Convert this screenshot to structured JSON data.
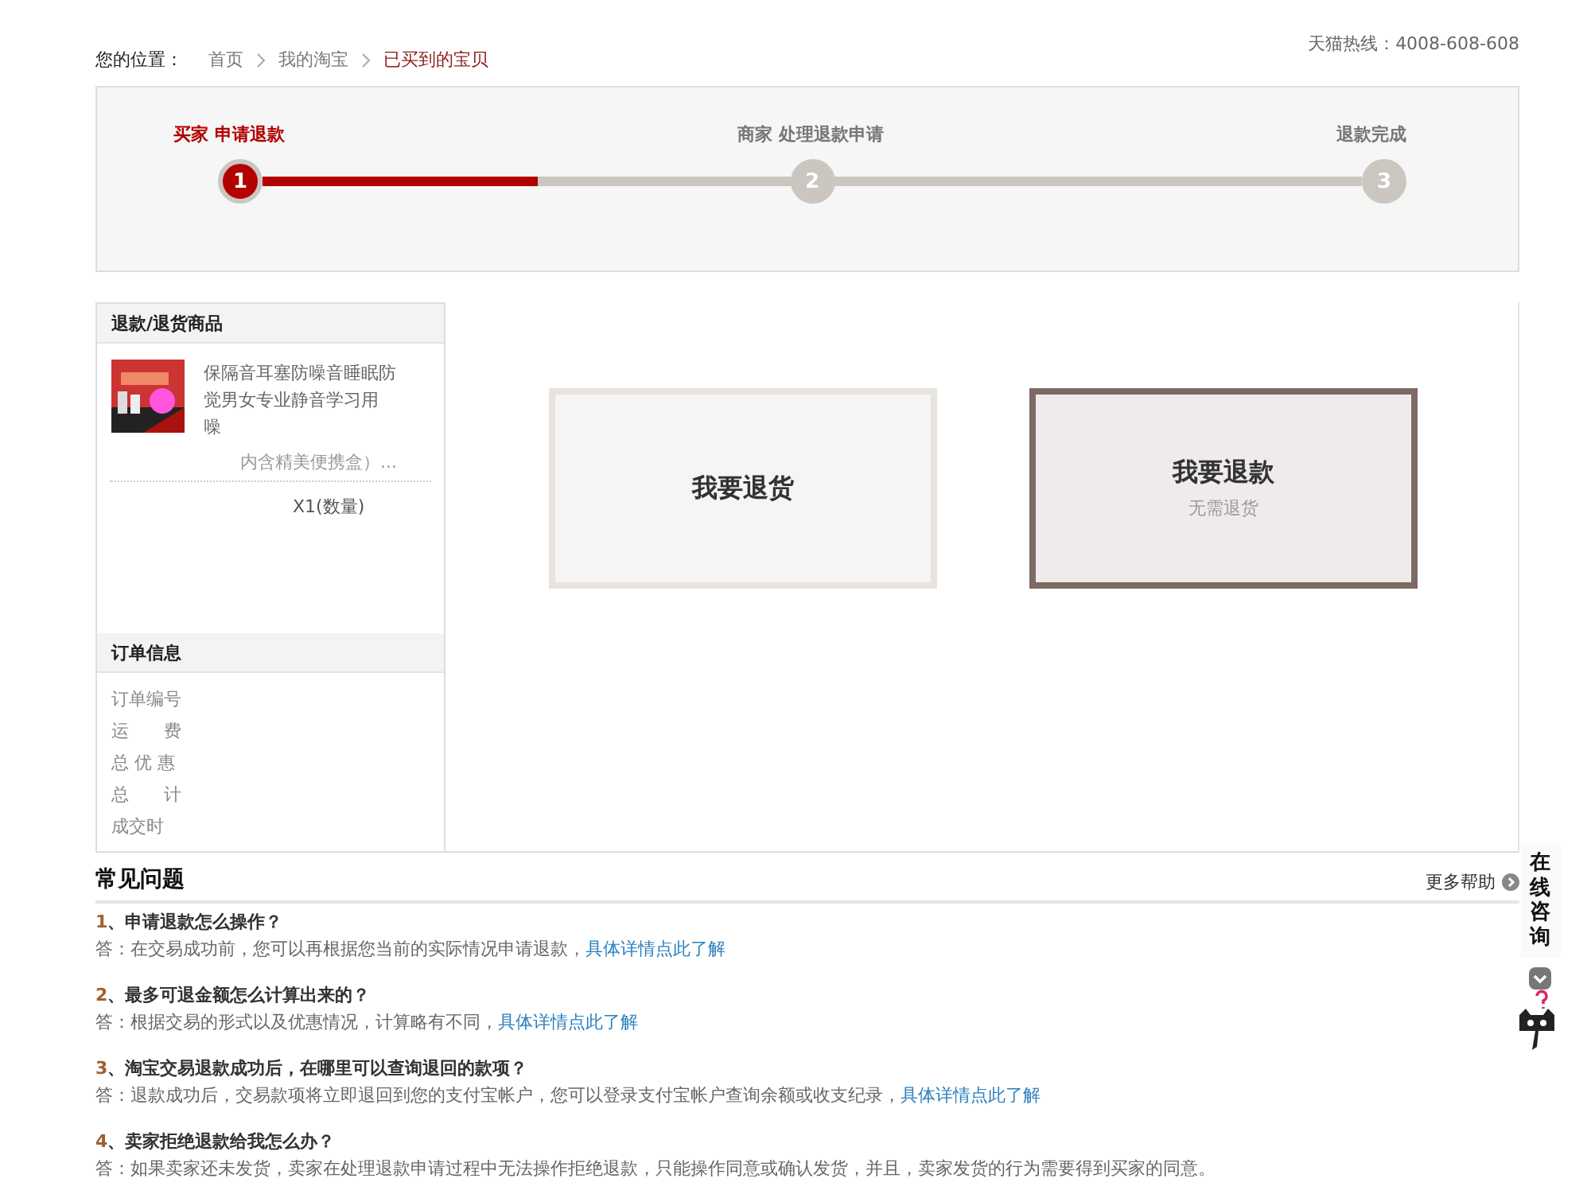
{
  "breadcrumb": {
    "label": "您的位置：",
    "items": [
      {
        "text": "首页",
        "selected": false
      },
      {
        "text": "我的淘宝",
        "selected": false
      },
      {
        "text": "已买到的宝贝",
        "selected": true
      }
    ]
  },
  "hotline": "天猫热线：4008-608-608",
  "steps": {
    "level": 0.25,
    "items": [
      {
        "title": "买家 申请退款",
        "number": "1",
        "selected": true
      },
      {
        "title": "商家 处理退款申请",
        "number": "2",
        "selected": false
      },
      {
        "title": "退款完成",
        "number": "3",
        "selected": false
      }
    ]
  },
  "goods_panel": {
    "title": "退款/退货商品",
    "product": {
      "title_lines": [
        "保隔音耳塞防噪音睡眠防",
        "觉男女专业静音学习用",
        "噪"
      ],
      "spec": "内含精美便携盒）...",
      "quantity": "X1(数量)"
    }
  },
  "order_panel": {
    "title": "订单信息",
    "rows": [
      {
        "label": "订单编号"
      },
      {
        "label": "运　　费"
      },
      {
        "label": "总 优 惠"
      },
      {
        "label": "总　　计"
      },
      {
        "label": "成交时"
      }
    ]
  },
  "options": [
    {
      "title": "我要退货",
      "selected": false
    },
    {
      "title": "我要退款",
      "subtitle": "无需退货",
      "selected": true
    }
  ],
  "faq": {
    "title": "常见问题",
    "more": "更多帮助",
    "items": [
      {
        "number": "1",
        "question": "、申请退款怎么操作？",
        "answer": "答：在交易成功前，您可以再根据您当前的实际情况申请退款，",
        "link": "具体详情点此了解"
      },
      {
        "number": "2",
        "question": "、最多可退金额怎么计算出来的？",
        "answer": "答：根据交易的形式以及优惠情况，计算略有不同，",
        "link": "具体详情点此了解"
      },
      {
        "number": "3",
        "question": "、淘宝交易退款成功后，在哪里可以查询退回的款项？",
        "answer": "答：退款成功后，交易款项将立即退回到您的支付宝帐户，您可以登录支付宝帐户查询余额或收支纪录，",
        "link": "具体详情点此了解"
      },
      {
        "number": "4",
        "question": "、卖家拒绝退款给我怎么办？",
        "answer": "答：如果卖家还未发货，卖家在处理退款申请过程中无法操作拒绝退款，只能操作同意或确认发货，并且，卖家发货的行为需要得到买家的同意。"
      }
    ]
  },
  "consult": {
    "label": "在线咨询"
  }
}
